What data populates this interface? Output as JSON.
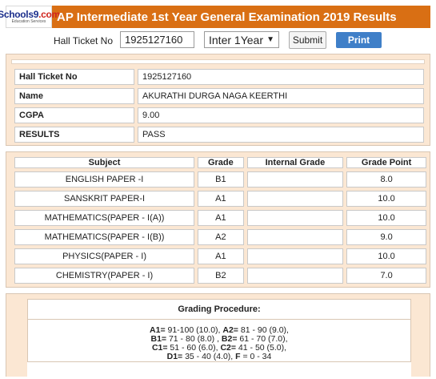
{
  "header": {
    "logo_text": "Schools9",
    "logo_tld": ".com",
    "logo_tagline": "Education Services",
    "title": "AP Intermediate 1st Year General Examination 2019 Results",
    "background_color": "#d96f14"
  },
  "search": {
    "label": "Hall Ticket No",
    "value": "1925127160",
    "year_selected": "Inter 1Year",
    "submit_label": "Submit",
    "print_label": "Print"
  },
  "student": {
    "rows": [
      {
        "label": "Hall Ticket No",
        "value": "1925127160"
      },
      {
        "label": "Name",
        "value": "AKURATHI DURGA NAGA KEERTHI"
      },
      {
        "label": "CGPA",
        "value": "9.00"
      },
      {
        "label": "RESULTS",
        "value": "PASS"
      }
    ]
  },
  "marks": {
    "headers": {
      "subject": "Subject",
      "grade": "Grade",
      "internal": "Internal Grade",
      "point": "Grade Point"
    },
    "rows": [
      {
        "subject": "ENGLISH PAPER -I",
        "grade": "B1",
        "internal": "",
        "point": "8.0"
      },
      {
        "subject": "SANSKRIT PAPER-I",
        "grade": "A1",
        "internal": "",
        "point": "10.0"
      },
      {
        "subject": "MATHEMATICS(PAPER - I(A))",
        "grade": "A1",
        "internal": "",
        "point": "10.0"
      },
      {
        "subject": "MATHEMATICS(PAPER - I(B))",
        "grade": "A2",
        "internal": "",
        "point": "9.0"
      },
      {
        "subject": "PHYSICS(PAPER - I)",
        "grade": "A1",
        "internal": "",
        "point": "10.0"
      },
      {
        "subject": "CHEMISTRY(PAPER - I)",
        "grade": "B2",
        "internal": "",
        "point": "7.0"
      }
    ]
  },
  "grading": {
    "title": "Grading Procedure:",
    "lines": [
      [
        {
          "k": "A1=",
          "v": " 91-100 (10.0), "
        },
        {
          "k": "A2=",
          "v": " 81 - 90 (9.0),"
        }
      ],
      [
        {
          "k": "B1=",
          "v": " 71 - 80 (8.0) , "
        },
        {
          "k": "B2=",
          "v": " 61 - 70 (7.0),"
        }
      ],
      [
        {
          "k": "C1=",
          "v": " 51 - 60 (6.0), "
        },
        {
          "k": "C2=",
          "v": " 41 - 50 (5.0),"
        }
      ],
      [
        {
          "k": "D1=",
          "v": " 35 - 40 (4.0), "
        },
        {
          "k": "F",
          "v": " = 0 - 34"
        }
      ]
    ]
  }
}
